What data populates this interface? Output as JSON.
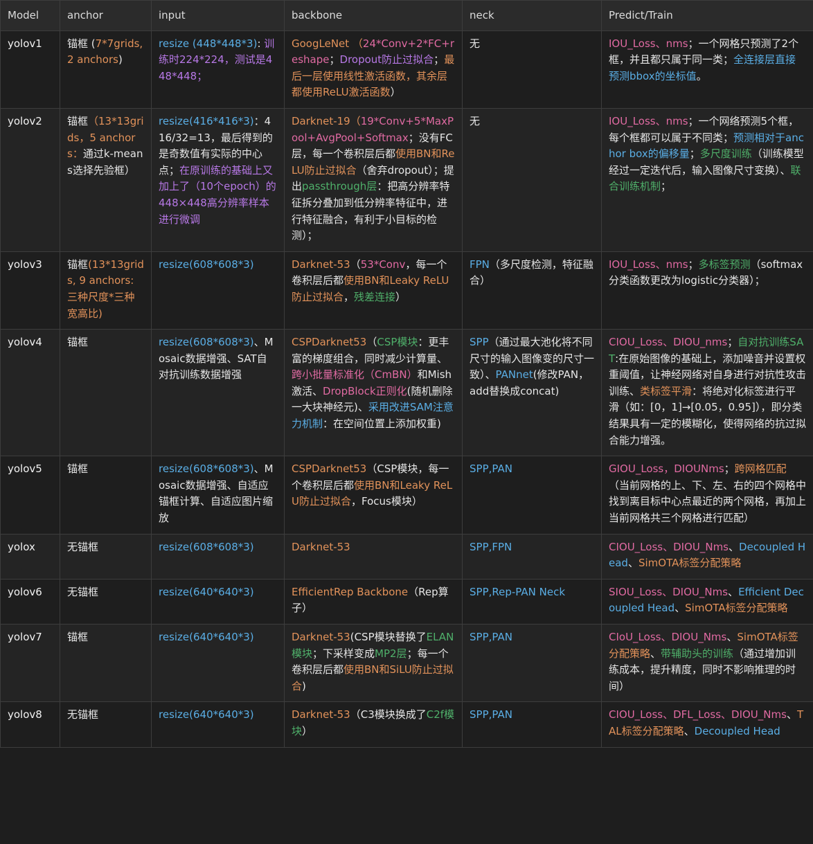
{
  "colors": {
    "w": "#e6e6e6",
    "o": "#e2925a",
    "b": "#5aaee5",
    "p": "#b778e6",
    "g": "#4fb06a",
    "m": "#e06aa2"
  },
  "headers": [
    "Model",
    "anchor",
    "input",
    "backbone",
    "neck",
    "Predict/Train"
  ],
  "rows": [
    {
      "model": "yolov1",
      "cells": [
        [
          [
            "w",
            "锚框 ("
          ],
          [
            "o",
            "7*7grids, 2 anchors"
          ],
          [
            "w",
            ")"
          ]
        ],
        [
          [
            "b",
            "resize (448*448*3)"
          ],
          [
            "w",
            ": "
          ],
          [
            "p",
            "训练时224*224，测试是448*448；"
          ]
        ],
        [
          [
            "o",
            "GoogLeNet （"
          ],
          [
            "m",
            "24*Conv+2*FC+reshape"
          ],
          [
            "w",
            "；"
          ],
          [
            "p",
            "Dropout防止过拟合"
          ],
          [
            "w",
            "；"
          ],
          [
            "o",
            "最后一层使用线性激活函数，其余层都使用ReLU激活函数"
          ],
          [
            "w",
            "）"
          ]
        ],
        [
          [
            "w",
            "无"
          ]
        ],
        [
          [
            "m",
            "IOU_Loss、nms"
          ],
          [
            "w",
            "；一个网格只预测了2个框，并且都只属于同一类；"
          ],
          [
            "b",
            "全连接层直接预测bbox的坐标值"
          ],
          [
            "w",
            "。"
          ]
        ]
      ]
    },
    {
      "model": "yolov2",
      "cells": [
        [
          [
            "w",
            "锚框"
          ],
          [
            "o",
            "（13*13grids，5 anchors："
          ],
          [
            "w",
            "通过k-means选择先验框）"
          ]
        ],
        [
          [
            "b",
            "resize(416*416*3)"
          ],
          [
            "w",
            "：416/32=13，最后得到的是奇数值有实际的中心点；"
          ],
          [
            "p",
            "在原训练的基础上又加上了（10个epoch）的448×448高分辨率样本进行微调"
          ]
        ],
        [
          [
            "o",
            "Darknet-19（"
          ],
          [
            "m",
            "19*Conv+5*MaxPool+AvgPool+Softmax"
          ],
          [
            "w",
            "；没有FC层，每一个卷积层后都"
          ],
          [
            "o",
            "使用BN和ReLU防止过拟合"
          ],
          [
            "w",
            "（舍弃dropout）；提出"
          ],
          [
            "g",
            "passthrough层"
          ],
          [
            "w",
            "：把高分辨率特征拆分叠加到低分辨率特征中，进行特征融合，有利于小目标的检测）；"
          ]
        ],
        [
          [
            "w",
            "无"
          ]
        ],
        [
          [
            "m",
            "IOU_Loss、nms"
          ],
          [
            "w",
            "；一个网络预测5个框，每个框都可以属于不同类；"
          ],
          [
            "b",
            "预测相对于anchor box的偏移量"
          ],
          [
            "w",
            "；"
          ],
          [
            "g",
            "多尺度训练"
          ],
          [
            "w",
            "（训练模型经过一定迭代后，输入图像尺寸变换）、"
          ],
          [
            "g",
            "联合训练机制"
          ],
          [
            "w",
            "；"
          ]
        ]
      ]
    },
    {
      "model": "yolov3",
      "cells": [
        [
          [
            "w",
            "锚框"
          ],
          [
            "o",
            "(13*13grids, 9 anchors: 三种尺度*三种宽高比)"
          ]
        ],
        [
          [
            "b",
            "resize(608*608*3)"
          ]
        ],
        [
          [
            "o",
            "Darknet-53"
          ],
          [
            "w",
            "（"
          ],
          [
            "m",
            "53*Conv"
          ],
          [
            "w",
            "，每一个卷积层后都"
          ],
          [
            "o",
            "使用BN和Leaky ReLU防止过拟合"
          ],
          [
            "w",
            "，"
          ],
          [
            "g",
            "残差连接"
          ],
          [
            "w",
            "）"
          ]
        ],
        [
          [
            "b",
            "FPN"
          ],
          [
            "w",
            "（多尺度检测，特征融合）"
          ]
        ],
        [
          [
            "m",
            "IOU_Loss、nms"
          ],
          [
            "w",
            "；"
          ],
          [
            "g",
            "多标签预测"
          ],
          [
            "w",
            "（softmax分类函数更改为logistic分类器）；"
          ]
        ]
      ]
    },
    {
      "model": "yolov4",
      "cells": [
        [
          [
            "w",
            "锚框"
          ]
        ],
        [
          [
            "b",
            "resize(608*608*3)"
          ],
          [
            "w",
            "、Mosaic数据增强、SAT自对抗训练数据增强"
          ]
        ],
        [
          [
            "o",
            "CSPDarknet53"
          ],
          [
            "w",
            "（"
          ],
          [
            "g",
            "CSP模块"
          ],
          [
            "w",
            "：更丰富的梯度组合，同时减少计算量、"
          ],
          [
            "m",
            "跨小批量标准化（CmBN）"
          ],
          [
            "w",
            "和Mish激活、"
          ],
          [
            "m",
            "DropBlock正则化"
          ],
          [
            "w",
            "(随机删除一大块神经元)、"
          ],
          [
            "b",
            "采用改进SAM注意力机制"
          ],
          [
            "w",
            "：在空间位置上添加权重)"
          ]
        ],
        [
          [
            "b",
            "SPP"
          ],
          [
            "w",
            "（通过最大池化将不同尺寸的输入图像变的尺寸一致）、"
          ],
          [
            "b",
            "PANnet"
          ],
          [
            "w",
            "(修改PAN，add替换成concat)"
          ]
        ],
        [
          [
            "m",
            "CIOU_Loss、DIOU_nms"
          ],
          [
            "w",
            "；"
          ],
          [
            "g",
            "自对抗训练SAT"
          ],
          [
            "w",
            ":在原始图像的基础上，添加噪音并设置权重阈值，让神经网络对自身进行对抗性攻击训练、"
          ],
          [
            "o",
            "类标签平滑"
          ],
          [
            "w",
            "：将绝对化标签进行平滑（如：[0，1]→[0.05，0.95]），即分类结果具有一定的模糊化，使得网络的抗过拟合能力增强。"
          ]
        ]
      ]
    },
    {
      "model": "yolov5",
      "cells": [
        [
          [
            "w",
            "锚框"
          ]
        ],
        [
          [
            "b",
            "resize(608*608*3)"
          ],
          [
            "w",
            "、Mosaic数据增强、自适应锚框计算、自适应图片缩放"
          ]
        ],
        [
          [
            "o",
            "CSPDarknet53"
          ],
          [
            "w",
            "（CSP模块，每一个卷积层后都"
          ],
          [
            "o",
            "使用BN和Leaky ReLU防止过拟合"
          ],
          [
            "w",
            "，Focus模块）"
          ]
        ],
        [
          [
            "b",
            "SPP,PAN"
          ]
        ],
        [
          [
            "m",
            "GIOU_Loss，DIOUNms"
          ],
          [
            "w",
            "；"
          ],
          [
            "o",
            "跨网格匹配"
          ],
          [
            "w",
            "（当前网格的上、下、左、右的四个网格中找到离目标中心点最近的两个网格，再加上当前网格共三个网格进行匹配）"
          ]
        ]
      ]
    },
    {
      "model": "yolox",
      "cells": [
        [
          [
            "w",
            "无锚框"
          ]
        ],
        [
          [
            "b",
            "resize(608*608*3)"
          ]
        ],
        [
          [
            "o",
            "Darknet-53"
          ]
        ],
        [
          [
            "b",
            "SPP,FPN"
          ]
        ],
        [
          [
            "m",
            "CIOU_Loss、DIOU_Nms"
          ],
          [
            "w",
            "、"
          ],
          [
            "b",
            "Decoupled Head"
          ],
          [
            "w",
            "、"
          ],
          [
            "o",
            "SimOTA标签分配策略"
          ]
        ]
      ]
    },
    {
      "model": "yolov6",
      "cells": [
        [
          [
            "w",
            "无锚框"
          ]
        ],
        [
          [
            "b",
            "resize(640*640*3)"
          ]
        ],
        [
          [
            "o",
            "EfficientRep Backbone"
          ],
          [
            "w",
            "（Rep算子）"
          ]
        ],
        [
          [
            "b",
            "SPP,Rep-PAN Neck"
          ]
        ],
        [
          [
            "m",
            "SIOU_Loss、DIOU_Nms"
          ],
          [
            "w",
            "、"
          ],
          [
            "b",
            "Efficient Decoupled Head"
          ],
          [
            "w",
            "、"
          ],
          [
            "o",
            "SimOTA标签分配策略"
          ]
        ]
      ]
    },
    {
      "model": "yolov7",
      "cells": [
        [
          [
            "w",
            "锚框"
          ]
        ],
        [
          [
            "b",
            "resize(640*640*3)"
          ]
        ],
        [
          [
            "o",
            "Darknet-53"
          ],
          [
            "w",
            "(CSP模块替换了"
          ],
          [
            "g",
            "ELAN模块"
          ],
          [
            "w",
            "；下采样变成"
          ],
          [
            "g",
            "MP2层"
          ],
          [
            "w",
            "；每一个卷积层后都"
          ],
          [
            "o",
            "使用BN和SiLU防止过拟合"
          ],
          [
            "w",
            ")"
          ]
        ],
        [
          [
            "b",
            "SPP,PAN"
          ]
        ],
        [
          [
            "m",
            "CIoU_Loss、DIOU_Nms"
          ],
          [
            "w",
            "、"
          ],
          [
            "o",
            "SimOTA标签分配策略"
          ],
          [
            "w",
            "、"
          ],
          [
            "g",
            "带辅助头的训练"
          ],
          [
            "w",
            "（通过增加训练成本，提升精度，同时不影响推理的时间）"
          ]
        ]
      ]
    },
    {
      "model": "yolov8",
      "cells": [
        [
          [
            "w",
            "无锚框"
          ]
        ],
        [
          [
            "b",
            "resize(640*640*3)"
          ]
        ],
        [
          [
            "o",
            "Darknet-53"
          ],
          [
            "w",
            "（C3模块换成了"
          ],
          [
            "g",
            "C2f模块"
          ],
          [
            "w",
            "）"
          ]
        ],
        [
          [
            "b",
            "SPP,PAN"
          ]
        ],
        [
          [
            "m",
            "CIOU_Loss、DFL_Loss、DIOU_Nms"
          ],
          [
            "w",
            "、"
          ],
          [
            "o",
            "TAL标签分配策略"
          ],
          [
            "w",
            "、"
          ],
          [
            "b",
            "Decoupled Head"
          ]
        ]
      ]
    }
  ]
}
